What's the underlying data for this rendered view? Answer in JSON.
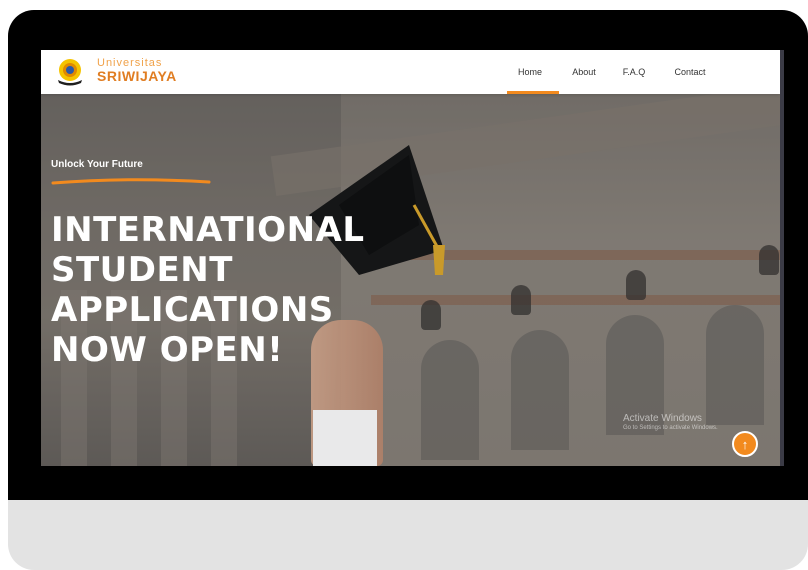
{
  "brand": {
    "line1": "Universitas",
    "line2": "SRIWIJAYA"
  },
  "nav": {
    "items": [
      {
        "label": "Home",
        "active": true
      },
      {
        "label": "About",
        "active": false
      },
      {
        "label": "F.A.Q",
        "active": false
      },
      {
        "label": "Contact",
        "active": false
      }
    ]
  },
  "hero": {
    "tagline": "Unlock Your Future",
    "headline": [
      "INTERNATIONAL",
      "STUDENT",
      "APPLICATIONS",
      "NOW OPEN!"
    ]
  },
  "watermark": {
    "title": "Activate Windows",
    "subtitle": "Go to Settings to activate Windows."
  },
  "scroll_top": {
    "icon": "arrow-up-icon"
  },
  "colors": {
    "accent": "#f28a1e",
    "brand_orange": "#e07d22",
    "bezel": "#000000",
    "monitor_base": "#e3e3e3"
  }
}
